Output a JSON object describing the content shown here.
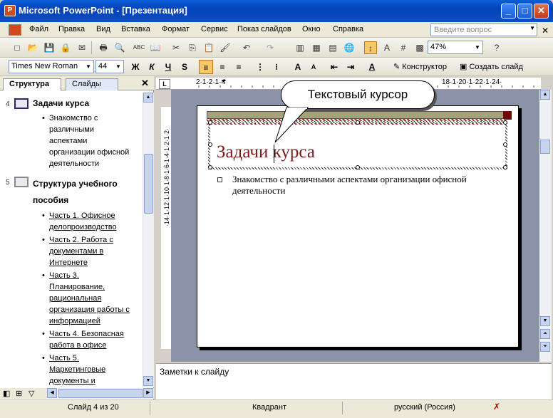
{
  "window": {
    "title": "Microsoft PowerPoint - [Презентация]"
  },
  "menu": {
    "items": [
      "Файл",
      "Правка",
      "Вид",
      "Вставка",
      "Формат",
      "Сервис",
      "Показ слайдов",
      "Окно",
      "Справка"
    ],
    "ask_placeholder": "Введите вопрос"
  },
  "toolbar": {
    "zoom": "47%",
    "font": "Times New Roman",
    "size": "44",
    "bold": "Ж",
    "italic": "К",
    "underline": "Ч",
    "shadow": "S",
    "designer": "Конструктор",
    "new_slide": "Создать слайд"
  },
  "pane": {
    "tab_outline": "Структура",
    "tab_slides": "Слайды",
    "slide4": {
      "num": "4",
      "title": "Задачи курса",
      "bullets": [
        "Знакомство с",
        "различными",
        "аспектами",
        "организации офисной",
        "деятельности"
      ]
    },
    "slide5": {
      "num": "5",
      "title_l1": "Структура учебного",
      "title_l2": "пособия",
      "items": [
        [
          "Часть 1. Офисное",
          "делопроизводство"
        ],
        [
          "Часть 2. Работа с",
          "документами в",
          "Интернете"
        ],
        [
          "Часть 3.",
          "Планирование,",
          "рациональная",
          "организация работы с",
          "информацией"
        ],
        [
          "Часть 4. Безопасная",
          "работа в офисе"
        ],
        [
          "Часть 5.",
          "Маркетинговые",
          "документы и"
        ]
      ]
    }
  },
  "slide": {
    "title": "Задачи курса",
    "body": "Знакомство с различными аспектами организации офисной деятельности"
  },
  "callout": "Текстовый курсор",
  "notes": "Заметки к слайду",
  "ruler": "2·1·2·1·4",
  "status": {
    "slide": "Слайд 4 из 20",
    "design": "Квадрант",
    "lang": "русский (Россия)"
  }
}
